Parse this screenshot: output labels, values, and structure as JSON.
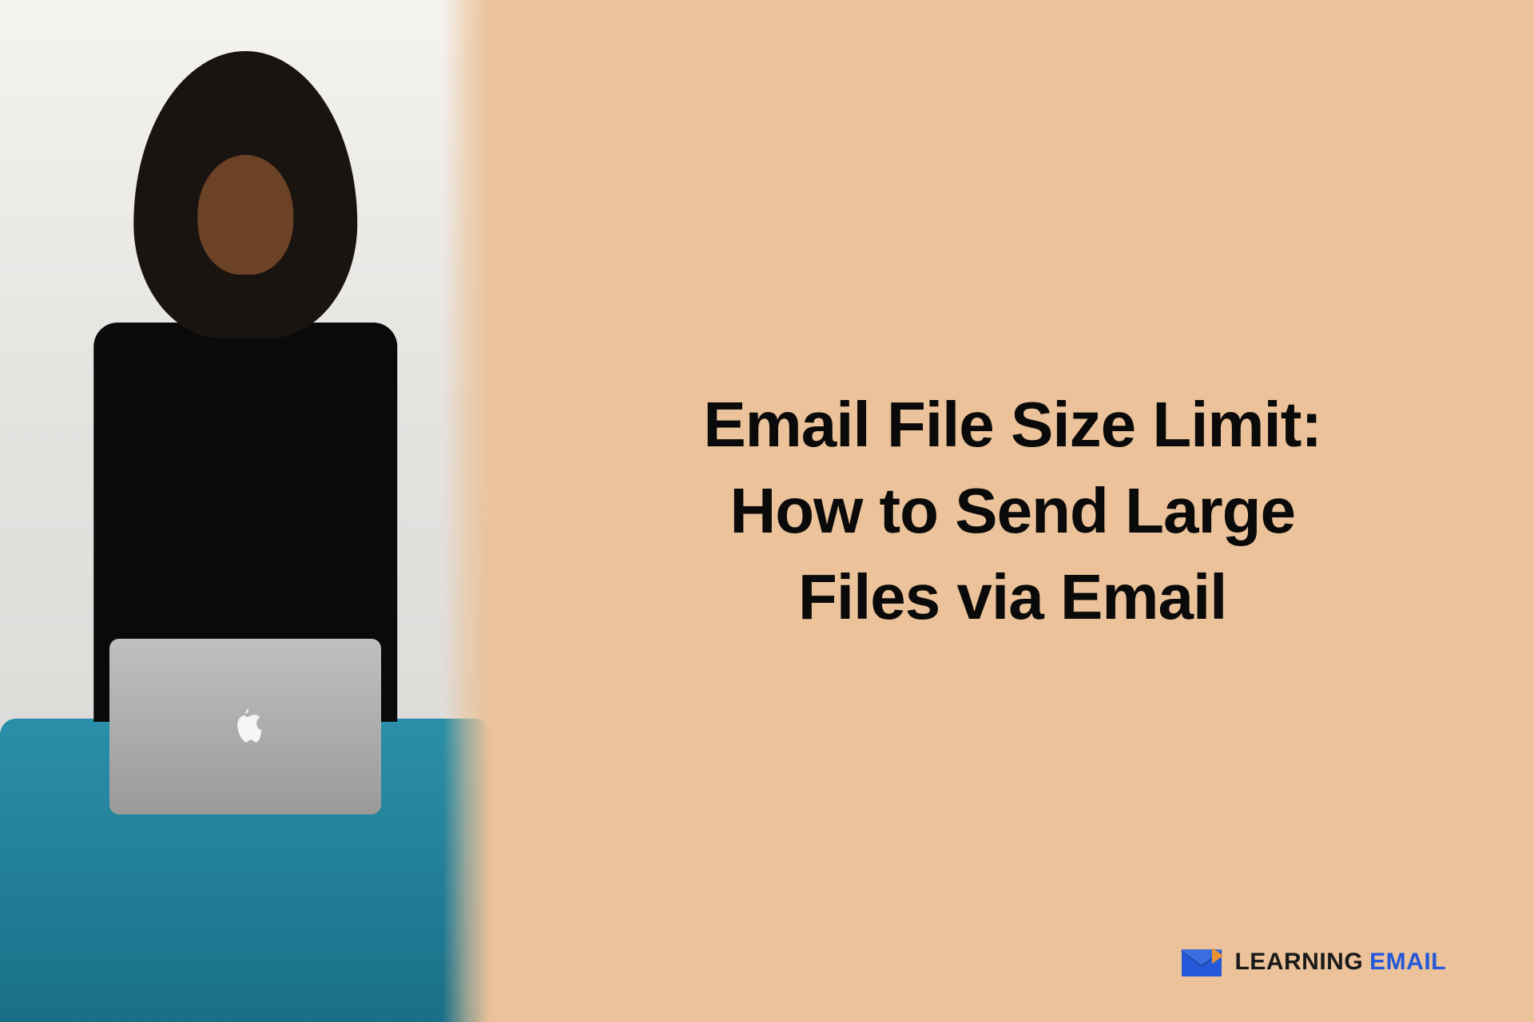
{
  "headline": "Email File Size Limit: How to Send Large Files via Email",
  "brand": {
    "word1": "LEARNING",
    "word2": "EMAIL",
    "icon_color_primary": "#2458d9",
    "icon_color_accent": "#e8932e"
  },
  "colors": {
    "background_right": "#ebc299",
    "headline_text": "#0a0a0a"
  }
}
